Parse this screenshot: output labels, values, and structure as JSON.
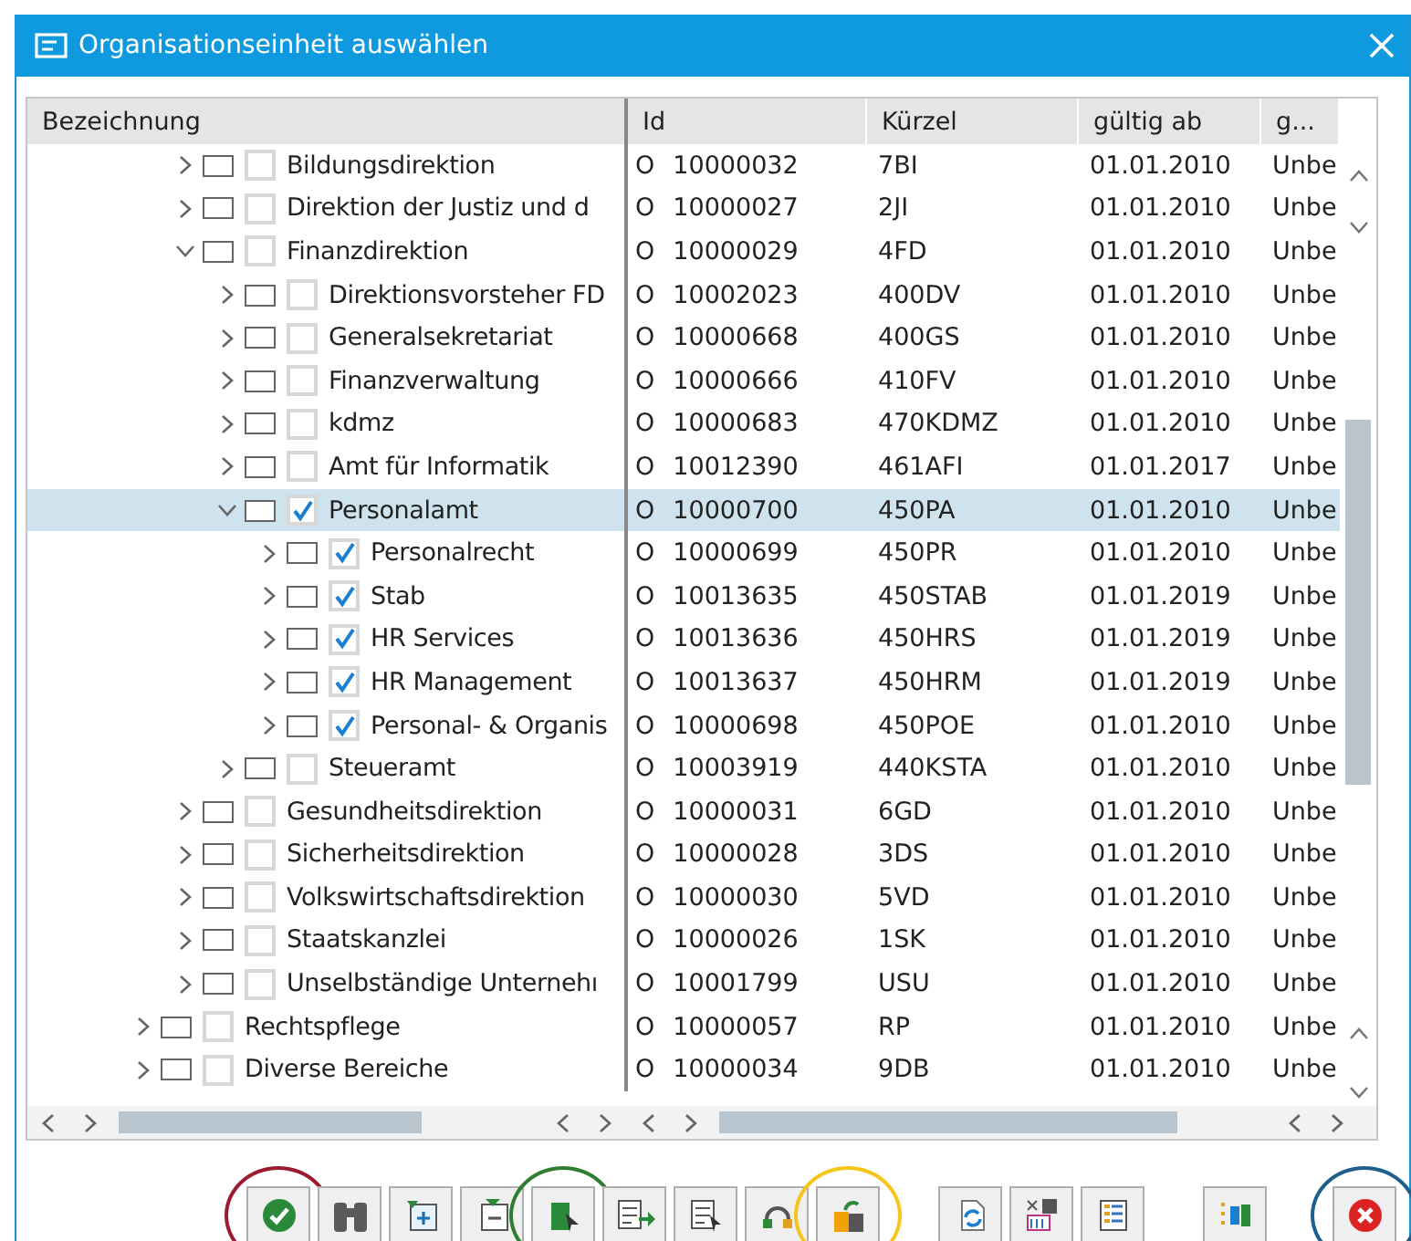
{
  "window": {
    "title": "Organisationseinheit auswählen"
  },
  "table": {
    "columns": [
      "Bezeichnung",
      "Id",
      "Kürzel",
      "gültig ab",
      "g..."
    ],
    "tree": [
      {
        "kind": "offscreen",
        "children": [
          {
            "kind": "node",
            "label": "Bildungsdirektion",
            "type": "O",
            "id": "10000032",
            "abbr": "7BI",
            "valid_from": "01.01.2010",
            "column_5": "Unbe",
            "expanded": false,
            "checked": false,
            "selected": false
          },
          {
            "kind": "node",
            "label": "Direktion der Justiz und d",
            "type": "O",
            "id": "10000027",
            "abbr": "2JI",
            "valid_from": "01.01.2010",
            "column_5": "Unbe",
            "expanded": false,
            "checked": false,
            "selected": false
          },
          {
            "kind": "node",
            "label": "Finanzdirektion",
            "type": "O",
            "id": "10000029",
            "abbr": "4FD",
            "valid_from": "01.01.2010",
            "column_5": "Unbe",
            "expanded": true,
            "checked": false,
            "selected": false,
            "children": [
              {
                "kind": "node",
                "label": "Direktionsvorsteher FD",
                "type": "O",
                "id": "10002023",
                "abbr": "400DV",
                "valid_from": "01.01.2010",
                "column_5": "Unbe",
                "expanded": false,
                "checked": false,
                "selected": false
              },
              {
                "kind": "node",
                "label": "Generalsekretariat",
                "type": "O",
                "id": "10000668",
                "abbr": "400GS",
                "valid_from": "01.01.2010",
                "column_5": "Unbe",
                "expanded": false,
                "checked": false,
                "selected": false
              },
              {
                "kind": "node",
                "label": "Finanzverwaltung",
                "type": "O",
                "id": "10000666",
                "abbr": "410FV",
                "valid_from": "01.01.2010",
                "column_5": "Unbe",
                "expanded": false,
                "checked": false,
                "selected": false
              },
              {
                "kind": "node",
                "label": "kdmz",
                "type": "O",
                "id": "10000683",
                "abbr": "470KDMZ",
                "valid_from": "01.01.2010",
                "column_5": "Unbe",
                "expanded": false,
                "checked": false,
                "selected": false
              },
              {
                "kind": "node",
                "label": "Amt für Informatik",
                "type": "O",
                "id": "10012390",
                "abbr": "461AFI",
                "valid_from": "01.01.2017",
                "column_5": "Unbe",
                "expanded": false,
                "checked": false,
                "selected": false
              },
              {
                "kind": "node",
                "label": "Personalamt",
                "type": "O",
                "id": "10000700",
                "abbr": "450PA",
                "valid_from": "01.01.2010",
                "column_5": "Unbe",
                "expanded": true,
                "checked": true,
                "selected": true,
                "children": [
                  {
                    "kind": "node",
                    "label": "Personalrecht",
                    "type": "O",
                    "id": "10000699",
                    "abbr": "450PR",
                    "valid_from": "01.01.2010",
                    "column_5": "Unbe",
                    "expanded": false,
                    "checked": true,
                    "selected": false
                  },
                  {
                    "kind": "node",
                    "label": "Stab",
                    "type": "O",
                    "id": "10013635",
                    "abbr": "450STAB",
                    "valid_from": "01.01.2019",
                    "column_5": "Unbe",
                    "expanded": false,
                    "checked": true,
                    "selected": false
                  },
                  {
                    "kind": "node",
                    "label": "HR Services",
                    "type": "O",
                    "id": "10013636",
                    "abbr": "450HRS",
                    "valid_from": "01.01.2019",
                    "column_5": "Unbe",
                    "expanded": false,
                    "checked": true,
                    "selected": false
                  },
                  {
                    "kind": "node",
                    "label": "HR Management",
                    "type": "O",
                    "id": "10013637",
                    "abbr": "450HRM",
                    "valid_from": "01.01.2019",
                    "column_5": "Unbe",
                    "expanded": false,
                    "checked": true,
                    "selected": false
                  },
                  {
                    "kind": "node",
                    "label": "Personal- & Organis",
                    "type": "O",
                    "id": "10000698",
                    "abbr": "450POE",
                    "valid_from": "01.01.2010",
                    "column_5": "Unbe",
                    "expanded": false,
                    "checked": true,
                    "selected": false
                  }
                ]
              },
              {
                "kind": "node",
                "label": "Steueramt",
                "type": "O",
                "id": "10003919",
                "abbr": "440KSTA",
                "valid_from": "01.01.2010",
                "column_5": "Unbe",
                "expanded": false,
                "checked": false,
                "selected": false
              }
            ]
          },
          {
            "kind": "node",
            "label": "Gesundheitsdirektion",
            "type": "O",
            "id": "10000031",
            "abbr": "6GD",
            "valid_from": "01.01.2010",
            "column_5": "Unbe",
            "expanded": false,
            "checked": false,
            "selected": false
          },
          {
            "kind": "node",
            "label": "Sicherheitsdirektion",
            "type": "O",
            "id": "10000028",
            "abbr": "3DS",
            "valid_from": "01.01.2010",
            "column_5": "Unbe",
            "expanded": false,
            "checked": false,
            "selected": false
          },
          {
            "kind": "node",
            "label": "Volkswirtschaftsdirektion",
            "type": "O",
            "id": "10000030",
            "abbr": "5VD",
            "valid_from": "01.01.2010",
            "column_5": "Unbe",
            "expanded": false,
            "checked": false,
            "selected": false
          },
          {
            "kind": "node",
            "label": "Staatskanzlei",
            "type": "O",
            "id": "10000026",
            "abbr": "1SK",
            "valid_from": "01.01.2010",
            "column_5": "Unbe",
            "expanded": false,
            "checked": false,
            "selected": false
          },
          {
            "kind": "node",
            "label": "Unselbständige Unternehı",
            "type": "O",
            "id": "10001799",
            "abbr": "USU",
            "valid_from": "01.01.2010",
            "column_5": "Unbe",
            "expanded": false,
            "checked": false,
            "selected": false
          }
        ]
      },
      {
        "kind": "node",
        "label": "Rechtspflege",
        "type": "O",
        "id": "10000057",
        "abbr": "RP",
        "valid_from": "01.01.2010",
        "column_5": "Unbe",
        "expanded": false,
        "checked": false,
        "selected": false
      },
      {
        "kind": "node",
        "label": "Diverse Bereiche",
        "type": "O",
        "id": "10000034",
        "abbr": "9DB",
        "valid_from": "01.01.2010",
        "column_5": "Unbe",
        "expanded": false,
        "checked": false,
        "selected": false
      }
    ]
  },
  "toolbar": [
    [
      {
        "kind": "confirm",
        "color": "#9b1b30"
      },
      {
        "kind": "find"
      },
      {
        "kind": "expand"
      },
      {
        "kind": "collapse"
      },
      {
        "kind": "select",
        "color": "#2e7d32"
      },
      {
        "kind": "select-sub"
      },
      {
        "kind": "deselect"
      },
      {
        "kind": "link"
      },
      {
        "kind": "transfer",
        "color": "#f5c518"
      }
    ],
    [
      {
        "kind": "refresh"
      },
      {
        "kind": "filter"
      },
      {
        "kind": "details"
      }
    ],
    [
      {
        "kind": "hierarchy"
      }
    ],
    [
      {
        "kind": "cancel",
        "color": "#1f5f8b"
      }
    ]
  ]
}
